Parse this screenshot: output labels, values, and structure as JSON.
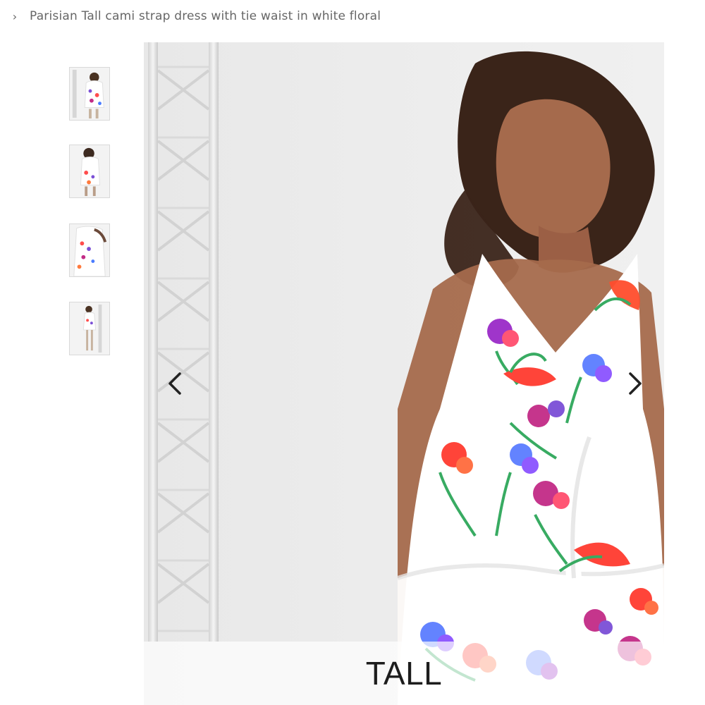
{
  "breadcrumb": {
    "separator": "›",
    "current": "Parisian Tall cami strap dress with tie waist in white floral"
  },
  "thumbnails": [
    {
      "name": "thumbnail-1"
    },
    {
      "name": "thumbnail-2"
    },
    {
      "name": "thumbnail-3"
    },
    {
      "name": "thumbnail-4"
    }
  ],
  "gallery": {
    "prev_icon": "chevron-left-icon",
    "next_icon": "chevron-right-icon",
    "overlay_label": "TALL"
  },
  "colors": {
    "text_muted": "#666666",
    "background": "#ffffff",
    "image_bg": "#e9e9e9",
    "overlay_text": "#1d1d1d"
  }
}
